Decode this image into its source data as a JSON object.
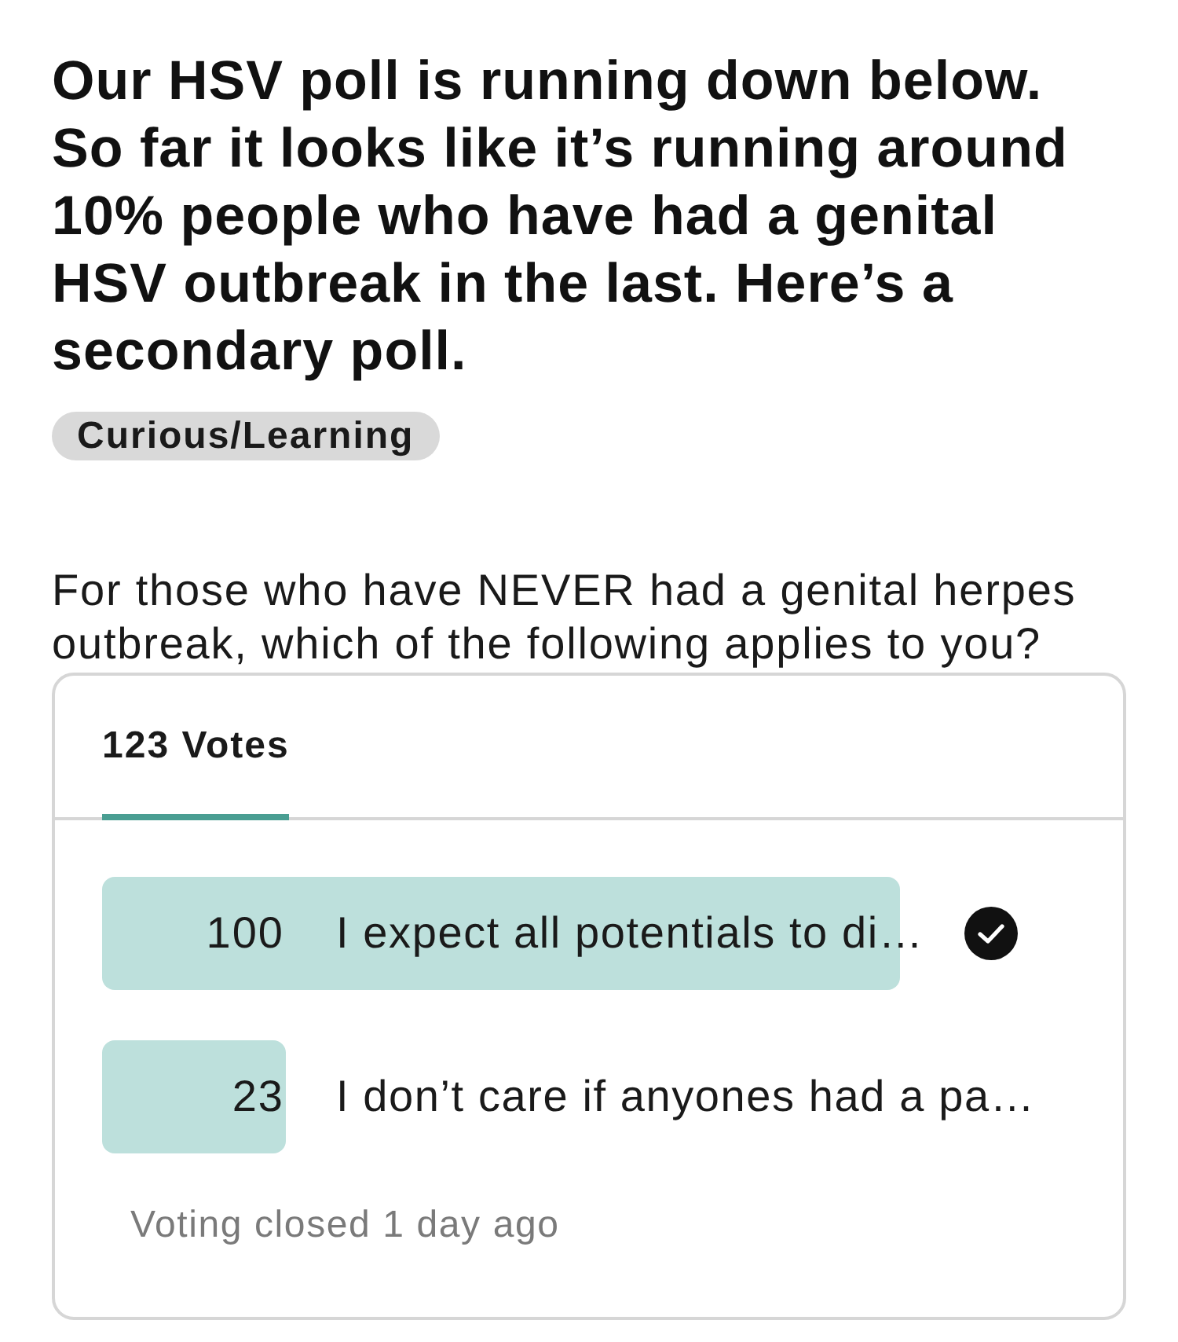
{
  "post": {
    "title": "Our HSV poll is running down below. So far it looks like it’s running around 10% people who have had a genital HSV outbreak in the last. Here’s a secondary poll.",
    "tag": "Curious/Learning",
    "question": "For those who have NEVER had a genital herpes outbreak, which of the following applies to you?"
  },
  "poll": {
    "tabs": [
      {
        "label": "123 Votes",
        "selected": true
      }
    ],
    "options": [
      {
        "count": "100",
        "text": "I expect all potentials to di…",
        "level": 0.813,
        "selected": true
      },
      {
        "count": "23",
        "text": "I don’t care if anyones had a pa…",
        "level": 0.187,
        "selected": false
      }
    ],
    "footer": "Voting closed 1 day ago"
  }
}
